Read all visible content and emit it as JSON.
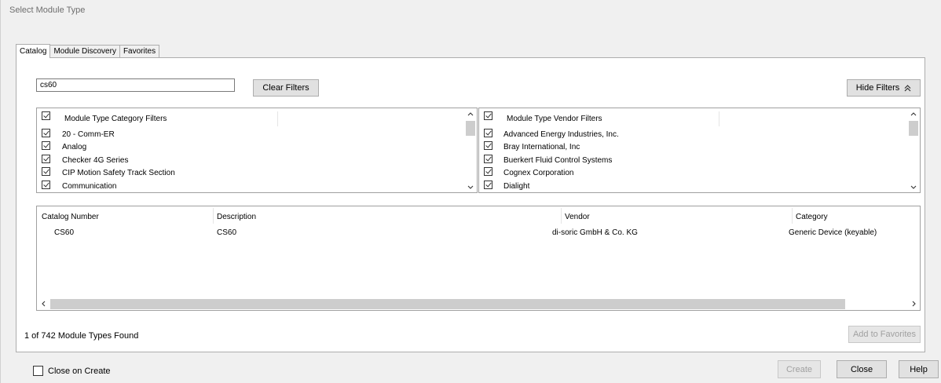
{
  "window": {
    "title": "Select Module Type"
  },
  "tabs": [
    {
      "label": "Catalog",
      "active": true
    },
    {
      "label": "Module Discovery",
      "active": false
    },
    {
      "label": "Favorites",
      "active": false
    }
  ],
  "search": {
    "value": "cs60"
  },
  "buttons": {
    "clear_filters": "Clear Filters",
    "hide_filters": "Hide Filters",
    "add_to_favorites": "Add to Favorites",
    "create": "Create",
    "close": "Close",
    "help": "Help"
  },
  "category_filters": {
    "header": "Module Type Category Filters",
    "items": [
      "20 - Comm-ER",
      "Analog",
      "Checker 4G Series",
      "CIP Motion Safety Track Section",
      "Communication"
    ]
  },
  "vendor_filters": {
    "header": "Module Type Vendor Filters",
    "items": [
      "Advanced Energy Industries, Inc.",
      "Bray International, Inc",
      "Buerkert Fluid Control Systems",
      "Cognex Corporation",
      "Dialight"
    ]
  },
  "results": {
    "columns": [
      "Catalog Number",
      "Description",
      "Vendor",
      "Category"
    ],
    "rows": [
      {
        "catalog_number": "CS60",
        "description": "CS60",
        "vendor": "di-soric GmbH & Co. KG",
        "category": "Generic Device (keyable)"
      }
    ]
  },
  "status": {
    "found_text": "1 of 742 Module Types Found"
  },
  "close_on_create": {
    "label": "Close on Create",
    "checked": false
  },
  "icons": {
    "hide_filters": "double-chevron-up-icon",
    "scroll_up": "chevron-up-icon",
    "scroll_down": "chevron-down-icon",
    "scroll_left": "chevron-left-icon",
    "scroll_right": "chevron-right-icon",
    "checkbox": "checkbox-checked-icon"
  }
}
